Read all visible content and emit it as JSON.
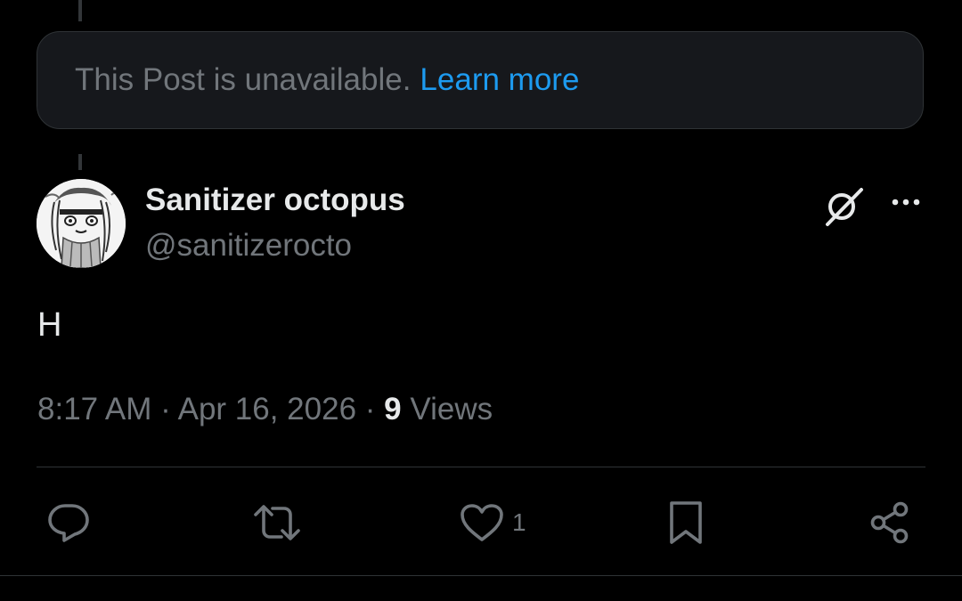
{
  "colors": {
    "background": "#000000",
    "card_background": "#16181c",
    "border": "#2f3336",
    "primary_text": "#e7e9ea",
    "secondary_text": "#71767b",
    "link": "#1d9bf0"
  },
  "quoted_post": {
    "message": "This Post is unavailable.",
    "learn_more": "Learn more"
  },
  "author": {
    "display_name": "Sanitizer octopus",
    "handle": "@sanitizerocto",
    "avatar_icon": "sketch-avatar"
  },
  "header_actions": {
    "grok_icon": "grok-icon",
    "more_icon": "more-horizontal-icon"
  },
  "post": {
    "text": "H",
    "time": "8:17 AM",
    "separator": "·",
    "date": "Apr 16, 2026",
    "views_count": "9",
    "views_label": "Views"
  },
  "actions": {
    "reply_icon": "reply-icon",
    "repost_icon": "repost-icon",
    "like_icon": "heart-icon",
    "like_count": "1",
    "bookmark_icon": "bookmark-icon",
    "share_icon": "share-icon"
  }
}
